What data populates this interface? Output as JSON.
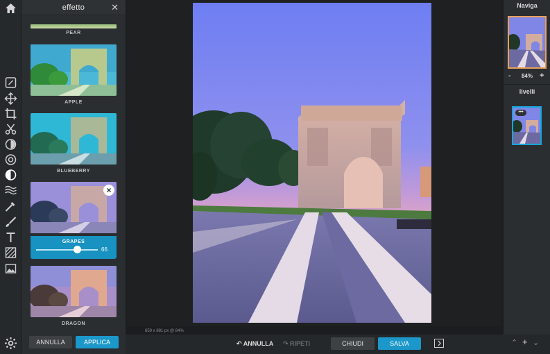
{
  "rail": {
    "tools": [
      "home-icon",
      "edit-icon",
      "move-icon",
      "crop-icon",
      "cut-icon",
      "adjust-icon",
      "filter-icon",
      "effect-icon",
      "wave-icon",
      "draw-icon",
      "brush-icon",
      "text-icon",
      "texture-icon",
      "image-icon",
      "settings-icon"
    ],
    "active": "effect-icon"
  },
  "panel": {
    "title": "effetto",
    "close": "✕",
    "effects": [
      {
        "label": "PEAR"
      },
      {
        "label": "APPLE"
      },
      {
        "label": "BLUEBERRY"
      },
      {
        "label": "GRAPES",
        "selected": true,
        "intensity": "66"
      },
      {
        "label": "DRAGON"
      }
    ],
    "cancel_label": "ANNULLA",
    "apply_label": "APPLICA"
  },
  "canvas": {
    "info": "659 x 881 px @ 84%"
  },
  "bottombar": {
    "undo_label": "ANNULLA",
    "redo_label": "RIPETI",
    "close_label": "CHIUDI",
    "save_label": "SALVA",
    "layer_add": "+"
  },
  "right": {
    "navigator_title": "Naviga",
    "zoom_minus": "-",
    "zoom": "84%",
    "zoom_plus": "+",
    "layers_title": "livelli",
    "layer_more": "•••"
  },
  "colors": {
    "accent": "#1c97c9",
    "nav_border": "#e8a05a"
  }
}
